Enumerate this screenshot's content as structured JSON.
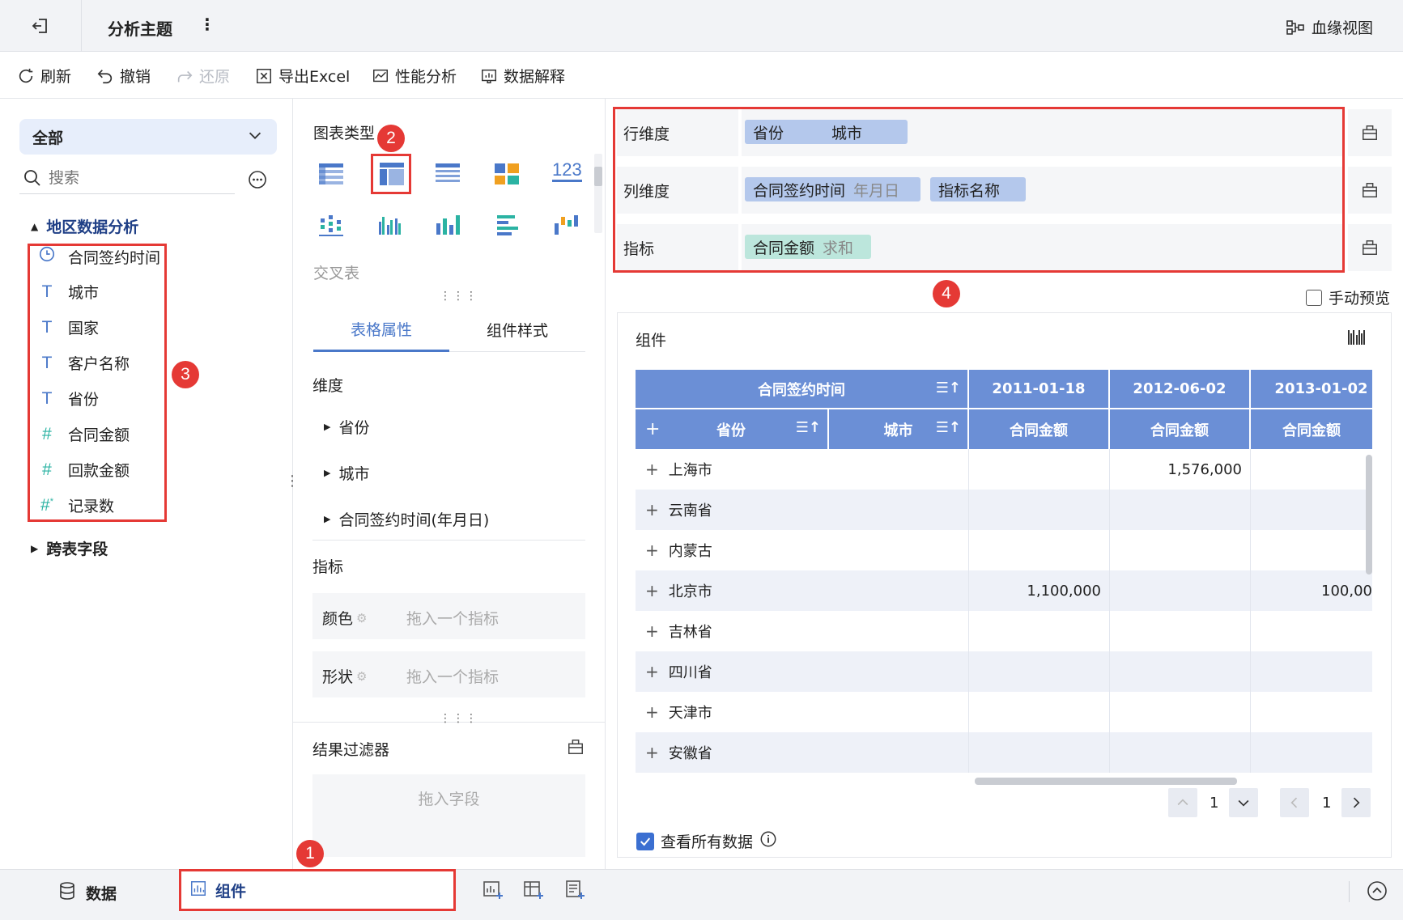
{
  "titlebar": {
    "title": "分析主题",
    "more": "⋮",
    "lineage": "血缘视图"
  },
  "toolbar": {
    "refresh": "刷新",
    "undo": "撤销",
    "redo": "还原",
    "export": "导出Excel",
    "perf": "性能分析",
    "explain": "数据解释"
  },
  "left": {
    "scope": "全部",
    "search_placeholder": "搜索",
    "group": "地区数据分析",
    "fields": [
      {
        "type": "time",
        "label": "合同签约时间"
      },
      {
        "type": "text",
        "label": "城市"
      },
      {
        "type": "text",
        "label": "国家"
      },
      {
        "type": "text",
        "label": "客户名称"
      },
      {
        "type": "text",
        "label": "省份"
      },
      {
        "type": "num",
        "label": "合同金额"
      },
      {
        "type": "num",
        "label": "回款金额"
      },
      {
        "type": "numc",
        "label": "记录数"
      }
    ],
    "cross": "跨表字段"
  },
  "middle": {
    "chart_type_label": "图表类型",
    "selected_chart_name": "交叉表",
    "tabs": [
      "表格属性",
      "组件样式"
    ],
    "dim_title": "维度",
    "dims": [
      "省份",
      "城市",
      "合同签约时间(年月日)"
    ],
    "metric_title": "指标",
    "color_label": "颜色",
    "shape_label": "形状",
    "drop_metric": "拖入一个指标",
    "filter_title": "结果过滤器",
    "drop_field": "拖入字段"
  },
  "right": {
    "row_dim": {
      "label": "行维度",
      "chips": [
        "省份",
        "城市"
      ]
    },
    "col_dim": {
      "label": "列维度",
      "chip1": "合同签约时间",
      "chip1_sub": "年月日",
      "chip2": "指标名称"
    },
    "metric": {
      "label": "指标",
      "chip": "合同金额",
      "chip_sub": "求和"
    },
    "manual_preview": "手动预览",
    "component_title": "组件",
    "table": {
      "h_time": "合同签约时间",
      "dates": [
        "2011-01-18",
        "2012-06-02",
        "2013-01-02"
      ],
      "plus": "+",
      "h_province": "省份",
      "h_city": "城市",
      "h_amount": "合同金额",
      "rows": [
        {
          "name": "上海市",
          "v": [
            "",
            "1,576,000",
            ""
          ]
        },
        {
          "name": "云南省",
          "v": [
            "",
            "",
            ""
          ]
        },
        {
          "name": "内蒙古",
          "v": [
            "",
            "",
            ""
          ]
        },
        {
          "name": "北京市",
          "v": [
            "1,100,000",
            "",
            "100,00"
          ]
        },
        {
          "name": "吉林省",
          "v": [
            "",
            "",
            ""
          ]
        },
        {
          "name": "四川省",
          "v": [
            "",
            "",
            ""
          ]
        },
        {
          "name": "天津市",
          "v": [
            "",
            "",
            ""
          ]
        },
        {
          "name": "安徽省",
          "v": [
            "",
            "",
            ""
          ]
        }
      ]
    },
    "pager1": "1",
    "pager2": "1",
    "view_all": "查看所有数据"
  },
  "bottom": {
    "data_tab": "数据",
    "component_tab": "组件"
  },
  "badges": [
    "1",
    "2",
    "3",
    "4"
  ],
  "colors": {
    "accent": "#4a78c9",
    "header": "#6b8fd6",
    "annotation": "#e53935",
    "chip_blue": "#b4c8ec",
    "chip_green": "#bce6dc"
  }
}
